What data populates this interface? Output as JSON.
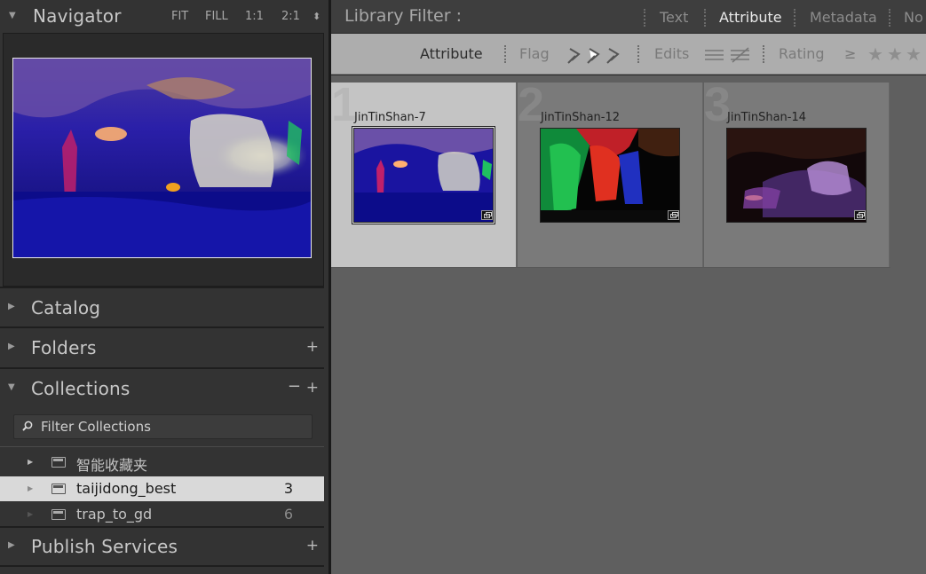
{
  "navigator": {
    "title": "Navigator",
    "zoom": [
      "FIT",
      "FILL",
      "1:1",
      "2:1"
    ]
  },
  "panels": {
    "catalog": "Catalog",
    "folders": "Folders",
    "collections": "Collections",
    "publish": "Publish Services"
  },
  "collections": {
    "filter_placeholder": "Filter Collections",
    "items": [
      {
        "name": "智能收藏夹",
        "count": ""
      },
      {
        "name": "taijidong_best",
        "count": "3"
      },
      {
        "name": "trap_to_gd",
        "count": "6"
      }
    ]
  },
  "library_filter": {
    "title": "Library Filter :",
    "tabs": [
      "Text",
      "Attribute",
      "Metadata",
      "No"
    ],
    "active_tab": "Attribute"
  },
  "attribute_bar": {
    "label": "Attribute",
    "flag": "Flag",
    "edits": "Edits",
    "rating": "Rating",
    "rating_op": "≥"
  },
  "grid": {
    "cells": [
      {
        "index": "1",
        "filename": "JinTinShan-7",
        "selected": true
      },
      {
        "index": "2",
        "filename": "JinTinShan-12",
        "selected": false
      },
      {
        "index": "3",
        "filename": "JinTinShan-14",
        "selected": false
      }
    ]
  },
  "colors": {
    "panel_bg": "#333333",
    "selected_row": "#d9d9d9",
    "grid_bg": "#5f5f5f",
    "active_tab": "#e8e8e8"
  }
}
